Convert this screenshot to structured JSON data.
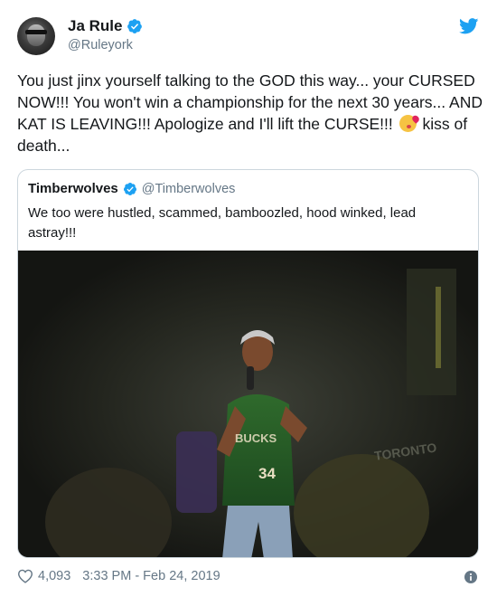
{
  "tweet": {
    "display_name": "Ja Rule",
    "handle": "@Ruleyork",
    "text_main": "You just jinx yourself talking to the GOD this way... your CURSED NOW!!! You won't win a championship for the next 30 years... AND KAT IS LEAVING!!! Apologize and I'll lift the CURSE!!! ",
    "text_tail": " kiss of death...",
    "emoji": "face-blowing-kiss-icon",
    "verified_icon": "verified-badge-icon",
    "brand_icon": "twitter-bird-icon",
    "brand_color": "#1da1f2"
  },
  "quoted_tweet": {
    "display_name": "Timberwolves",
    "handle": "@Timberwolves",
    "text": "We too were hustled, scammed, bamboozled, hood winked, lead astray!!!",
    "media_jersey_number": "34",
    "media_jersey_lettering": "BUCKS",
    "media_arena_text": "TORONTO"
  },
  "footer": {
    "likes": "4,093",
    "timestamp": "3:33 PM - Feb 24, 2019",
    "like_icon": "heart-icon",
    "info_icon": "info-icon"
  }
}
